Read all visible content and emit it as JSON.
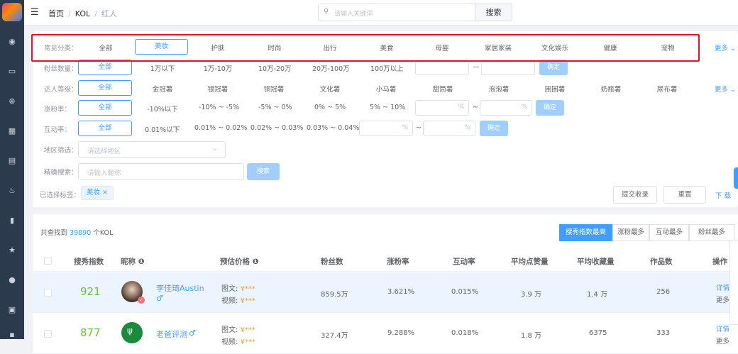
{
  "breadcrumb": {
    "home": "首页",
    "kol": "KOL",
    "current": "红人"
  },
  "search": {
    "placeholder": "请输入关键词",
    "button": "搜索"
  },
  "filters": {
    "category": {
      "label": "常见分类：",
      "options": [
        "全部",
        "美妆",
        "护肤",
        "时尚",
        "出行",
        "美食",
        "母婴",
        "家居家装",
        "文化娱乐",
        "健康",
        "宠物"
      ],
      "selected": "美妆",
      "more": "更多"
    },
    "fans": {
      "label": "粉丝数量：",
      "options": [
        "全部",
        "1万以下",
        "1万-10万",
        "10万-20万",
        "20万-100万",
        "100万以上"
      ],
      "selected": "全部",
      "confirm": "确定"
    },
    "level": {
      "label": "达人等级：",
      "options": [
        "全部",
        "金冠薯",
        "银冠薯",
        "铜冠薯",
        "文化薯",
        "小马薯",
        "甜筒薯",
        "泡泡薯",
        "困困薯",
        "奶瓶薯",
        "尿布薯"
      ],
      "selected": "全部",
      "more": "更多"
    },
    "growth": {
      "label": "涨粉率：",
      "options": [
        "全部",
        "-10%以下",
        "-10% ~ -5%",
        "-5% ~ 0%",
        "0% ~ 5%",
        "5% ~ 10%"
      ],
      "selected": "全部",
      "unit": "%",
      "dash": "~",
      "confirm": "确定"
    },
    "interaction": {
      "label": "互动率：",
      "options": [
        "全部",
        "0.01%以下",
        "0.01% ~ 0.02%",
        "0.02% ~ 0.03%",
        "0.03% ~ 0.04%"
      ],
      "selected": "全部",
      "unit": "%",
      "dash": "~",
      "confirm": "确定"
    },
    "region": {
      "label": "地区筛选：",
      "placeholder": "请选择地区"
    },
    "precise": {
      "label": "精确搜索：",
      "placeholder": "请输入昵称",
      "button": "搜索"
    },
    "selected_tags": {
      "label": "已选择标签：",
      "tags": [
        "美妆"
      ]
    },
    "actions": {
      "submit": "提交收录",
      "reset": "重置",
      "download": "下 载"
    }
  },
  "results": {
    "total_prefix": "共查找到",
    "total_count": "39890",
    "total_suffix": "个KOL",
    "sorts": [
      "搜秀指数最高",
      "涨粉最多",
      "互动最多",
      "粉丝最多"
    ],
    "active_sort": "搜秀指数最高",
    "columns": [
      "搜秀指数",
      "昵称",
      "预估价格",
      "粉丝数",
      "涨粉率",
      "互动率",
      "平均点赞量",
      "平均收藏量",
      "作品数",
      "操作"
    ],
    "rows": [
      {
        "score": "921",
        "name": "李佳琦Austin",
        "gender": "♂",
        "price_img_label": "图文:",
        "price_img": "¥***",
        "price_vid_label": "视频:",
        "price_vid": "¥***",
        "fans": "859.5万",
        "growth": "3.621%",
        "interaction": "0.015%",
        "likes": "3.9 万",
        "collects": "1.4 万",
        "works": "256",
        "op1": "详情",
        "op2": "更多"
      },
      {
        "score": "877",
        "name": "老爸评测",
        "gender": "♂",
        "price_img_label": "图文:",
        "price_img": "¥***",
        "price_vid_label": "视频:",
        "price_vid": "¥***",
        "fans": "327.4万",
        "growth": "9.288%",
        "interaction": "0.018%",
        "likes": "1.8 万",
        "collects": "6375",
        "works": "333",
        "op1": "详情",
        "op2": "更多"
      }
    ]
  },
  "colors": {
    "accent": "#409eff",
    "score": "#67c23a",
    "highlight": "#e8132b",
    "sidebar": "#2b3a4d"
  }
}
